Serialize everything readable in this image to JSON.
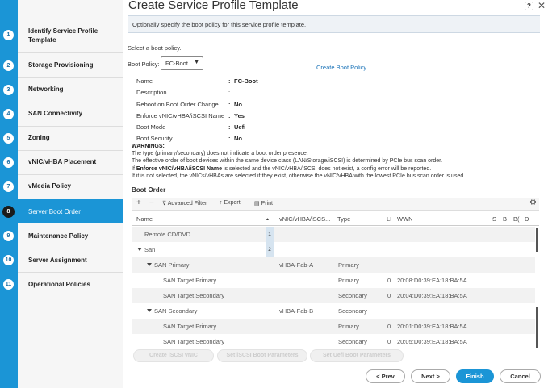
{
  "header": {
    "title": "Create Service Profile Template",
    "help": "?",
    "close": "✕"
  },
  "info": "Optionally specify the boot policy for this service profile template.",
  "sidebar": {
    "items": [
      {
        "num": "1",
        "label": "Identify Service Profile Template"
      },
      {
        "num": "2",
        "label": "Storage Provisioning"
      },
      {
        "num": "3",
        "label": "Networking"
      },
      {
        "num": "4",
        "label": "SAN Connectivity"
      },
      {
        "num": "5",
        "label": "Zoning"
      },
      {
        "num": "6",
        "label": "vNIC/vHBA Placement"
      },
      {
        "num": "7",
        "label": "vMedia Policy"
      },
      {
        "num": "8",
        "label": "Server Boot Order"
      },
      {
        "num": "9",
        "label": "Maintenance Policy"
      },
      {
        "num": "10",
        "label": "Server Assignment"
      },
      {
        "num": "11",
        "label": "Operational Policies"
      }
    ]
  },
  "boot": {
    "select_text": "Select a boot policy.",
    "policy_label": "Boot Policy:",
    "policy_value": "FC-Boot",
    "create_link": "Create Boot Policy"
  },
  "props": [
    {
      "key": "Name",
      "val": "FC-Boot"
    },
    {
      "key": "Description",
      "val": ""
    },
    {
      "key": "Reboot on Boot Order Change",
      "val": "No"
    },
    {
      "key": "Enforce vNIC/vHBA/iSCSI Name",
      "val": "Yes"
    },
    {
      "key": "Boot Mode",
      "val": "Uefi"
    },
    {
      "key": "Boot Security",
      "val": "No"
    }
  ],
  "warnings": {
    "title": "WARNINGS:",
    "l1": "The type (primary/secondary) does not indicate a boot order presence.",
    "l2": "The effective order of boot devices within the same device class (LAN/Storage/iSCSI) is determined by PCIe bus scan order.",
    "l3a": "If ",
    "l3b": "Enforce vNIC/vHBA/iSCSI Name",
    "l3c": " is selected and the vNIC/vHBA/iSCSI does not exist, a config error will be reported.",
    "l4": "If it is not selected, the vNICs/vHBAs are selected if they exist, otherwise the vNIC/vHBA with the lowest PCIe bus scan order is used."
  },
  "boot_order": {
    "title": "Boot Order",
    "toolbar": {
      "add": "+",
      "remove": "−",
      "filter": "Advanced Filter",
      "export": "Export",
      "print": "Print"
    },
    "columns": [
      "Name",
      "▲",
      "vNIC/vHBA/iSCS...",
      "Type",
      "LI",
      "WWN",
      "S",
      "B",
      "B(",
      "D"
    ],
    "rows": [
      {
        "name": "Remote CD/DVD",
        "order": "1",
        "vhba": "",
        "type": "",
        "lun": "",
        "wwn": ""
      },
      {
        "name": "San",
        "order": "2",
        "vhba": "",
        "type": "",
        "lun": "",
        "wwn": ""
      },
      {
        "name": "SAN Primary",
        "order": "",
        "vhba": "vHBA-Fab-A",
        "type": "Primary",
        "lun": "",
        "wwn": ""
      },
      {
        "name": "SAN Target Primary",
        "order": "",
        "vhba": "",
        "type": "Primary",
        "lun": "0",
        "wwn": "20:08:D0:39:EA:18:BA:5A"
      },
      {
        "name": "SAN Target Secondary",
        "order": "",
        "vhba": "",
        "type": "Secondary",
        "lun": "0",
        "wwn": "20:04:D0:39:EA:18:BA:5A"
      },
      {
        "name": "SAN Secondary",
        "order": "",
        "vhba": "vHBA-Fab-B",
        "type": "Secondary",
        "lun": "",
        "wwn": ""
      },
      {
        "name": "SAN Target Primary",
        "order": "",
        "vhba": "",
        "type": "Primary",
        "lun": "0",
        "wwn": "20:01:D0:39:EA:18:BA:5A"
      },
      {
        "name": "SAN Target Secondary",
        "order": "",
        "vhba": "",
        "type": "Secondary",
        "lun": "0",
        "wwn": "20:05:D0:39:EA:18:BA:5A"
      }
    ],
    "actions": [
      "Create iSCSI vNIC",
      "Set iSCSI Boot Parameters",
      "Set Uefi Boot Parameters"
    ]
  },
  "footer": {
    "prev": "< Prev",
    "next": "Next >",
    "finish": "Finish",
    "cancel": "Cancel"
  },
  "colors": {
    "accent": "#1b95d6",
    "link": "#1a73b8"
  }
}
